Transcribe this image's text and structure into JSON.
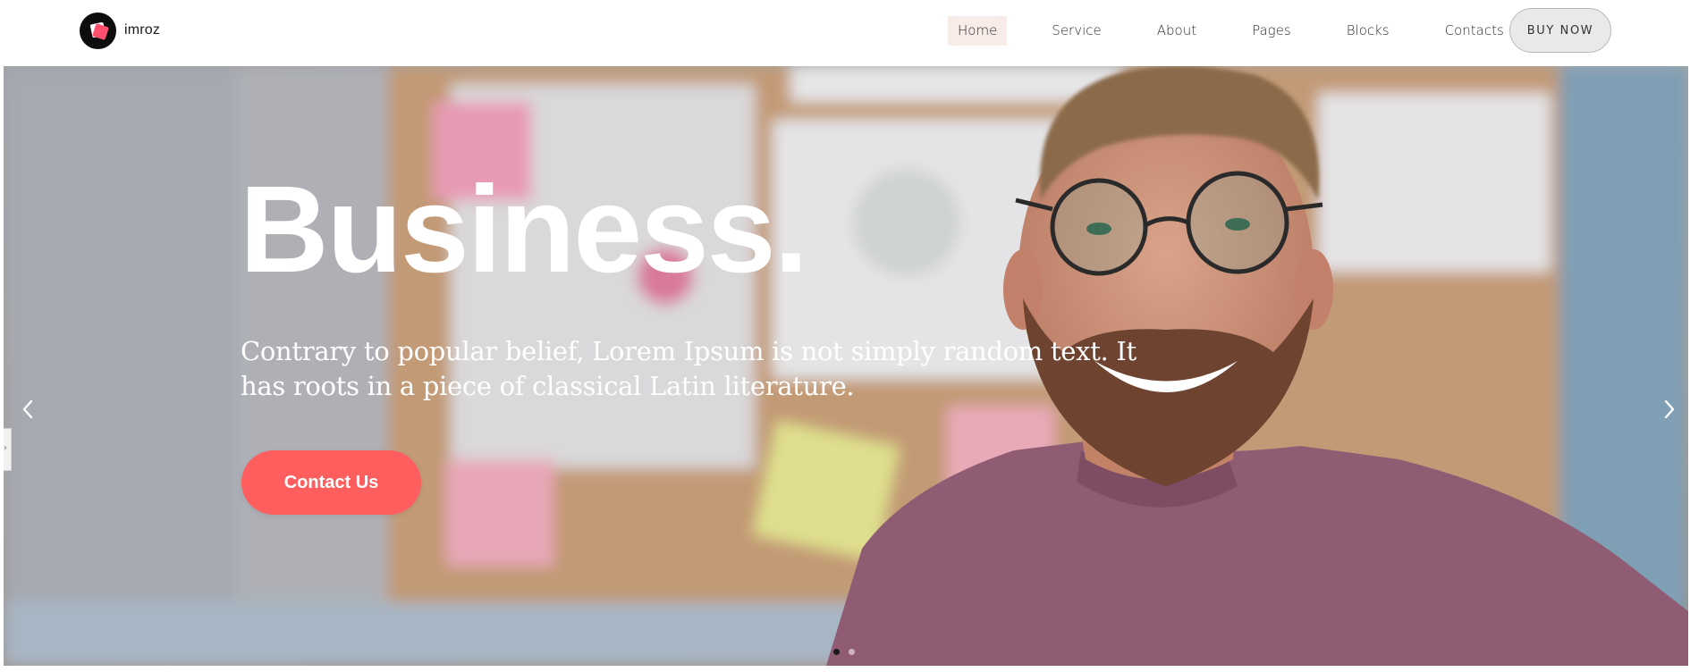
{
  "brand": {
    "name": "imroz",
    "logo_icon": "imroz-logo-icon"
  },
  "nav": {
    "items": [
      {
        "label": "Home",
        "active": true
      },
      {
        "label": "Service",
        "active": false
      },
      {
        "label": "About",
        "active": false
      },
      {
        "label": "Pages",
        "active": false
      },
      {
        "label": "Blocks",
        "active": false
      },
      {
        "label": "Contacts",
        "active": false
      }
    ],
    "cta_label": "BUY NOW"
  },
  "hero": {
    "title": "Business.",
    "subtitle": "Contrary to popular belief, Lorem Ipsum is not simply random text. It has roots in a piece of classical Latin literature.",
    "button_label": "Contact Us",
    "prev_icon": "chevron-left-icon",
    "next_icon": "chevron-right-icon",
    "slides": [
      {
        "active": true
      },
      {
        "active": false
      }
    ]
  },
  "side_tab": {
    "glyph": "›"
  },
  "colors": {
    "accent": "#ff5e5e",
    "nav_active_bg": "#f8ece8",
    "text_dark": "#2b2b2b",
    "white": "#ffffff"
  }
}
